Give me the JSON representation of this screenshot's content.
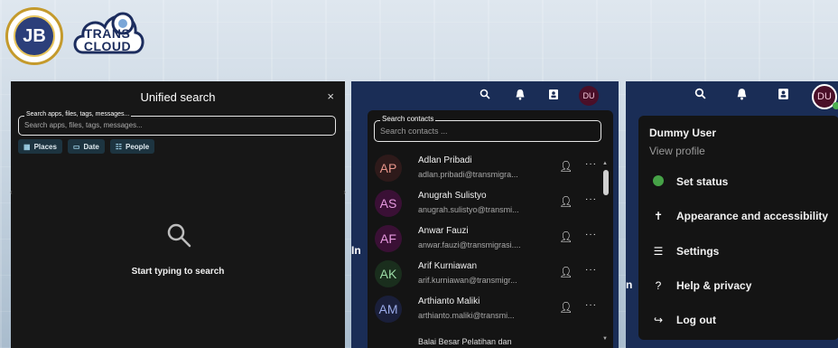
{
  "logos": {
    "left_logo_text": "JB",
    "right_logo_text": "TRANS CLOUD"
  },
  "search_panel": {
    "title": "Unified search",
    "close_glyph": "×",
    "field_label": "Search apps, files, tags, messages...",
    "placeholder": "Search apps, files, tags, messages...",
    "chips": [
      {
        "icon": "places-icon",
        "glyph": "▦",
        "label": "Places"
      },
      {
        "icon": "calendar-icon",
        "glyph": "▭",
        "label": "Date"
      },
      {
        "icon": "people-icon",
        "glyph": "☷",
        "label": "People"
      }
    ],
    "empty_text": "Start typing to search"
  },
  "contacts_panel": {
    "user_initials": "DU",
    "field_label": "Search contacts",
    "placeholder": "Search contacts ...",
    "partial_heading": "In",
    "contacts": [
      {
        "initials": "AP",
        "name": "Adlan Pribadi",
        "email": "adlan.pribadi@transmigra...",
        "bg": "#2e1a1a",
        "fg": "#e8958a"
      },
      {
        "initials": "AS",
        "name": "Anugrah Sulistyo",
        "email": "anugrah.sulistyo@transmi...",
        "bg": "#3a1035",
        "fg": "#e79ae0"
      },
      {
        "initials": "AF",
        "name": "Anwar Fauzi",
        "email": "anwar.fauzi@transmigrasi....",
        "bg": "#3a1035",
        "fg": "#e79ae0"
      },
      {
        "initials": "AK",
        "name": "Arif Kurniawan",
        "email": "arif.kurniawan@transmigr...",
        "bg": "#1a2e1d",
        "fg": "#9cdca6"
      },
      {
        "initials": "AM",
        "name": "Arthianto Maliki",
        "email": "arthianto.maliki@transmi...",
        "bg": "#1a1f3a",
        "fg": "#9aaae8"
      }
    ],
    "next_partial": "Balai Besar Pelatihan dan"
  },
  "user_menu": {
    "user_initials": "DU",
    "name": "Dummy User",
    "view_profile": "View profile",
    "partial_left": "n",
    "items": [
      {
        "icon": "status-dot-icon",
        "label": "Set status"
      },
      {
        "icon": "accessibility-icon",
        "glyph": "✝",
        "label": "Appearance and accessibility"
      },
      {
        "icon": "settings-sliders-icon",
        "glyph": "☰",
        "label": "Settings"
      },
      {
        "icon": "help-icon",
        "glyph": "?",
        "label": "Help & privacy"
      },
      {
        "icon": "logout-icon",
        "glyph": "↪",
        "label": "Log out"
      }
    ]
  },
  "colors": {
    "topbar": "#1a2d56",
    "panel_dark": "#141414",
    "status_green": "#46a247",
    "avatar_bg": "#4a0f28"
  }
}
